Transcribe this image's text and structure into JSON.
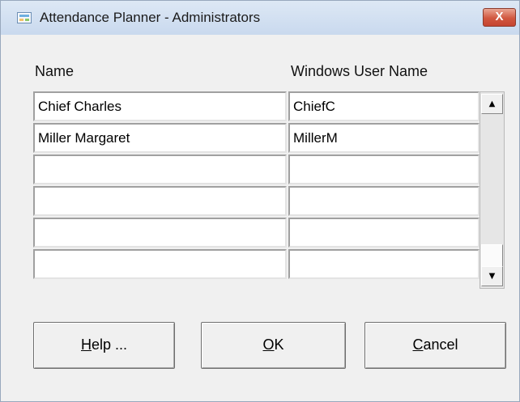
{
  "window": {
    "title": "Attendance Planner - Administrators",
    "close_label": "X"
  },
  "columns": {
    "name": "Name",
    "user": "Windows User Name"
  },
  "rows": [
    {
      "name": "Chief Charles",
      "user": "ChiefC"
    },
    {
      "name": "Miller Margaret",
      "user": "MillerM"
    },
    {
      "name": "",
      "user": ""
    },
    {
      "name": "",
      "user": ""
    },
    {
      "name": "",
      "user": ""
    },
    {
      "name": "",
      "user": ""
    }
  ],
  "scroll": {
    "up_arrow": "▲",
    "down_arrow": "▼"
  },
  "buttons": {
    "help": {
      "accel": "H",
      "rest": "elp ..."
    },
    "ok": {
      "accel": "O",
      "rest": "K"
    },
    "cancel": {
      "accel": "C",
      "rest": "ancel"
    }
  }
}
